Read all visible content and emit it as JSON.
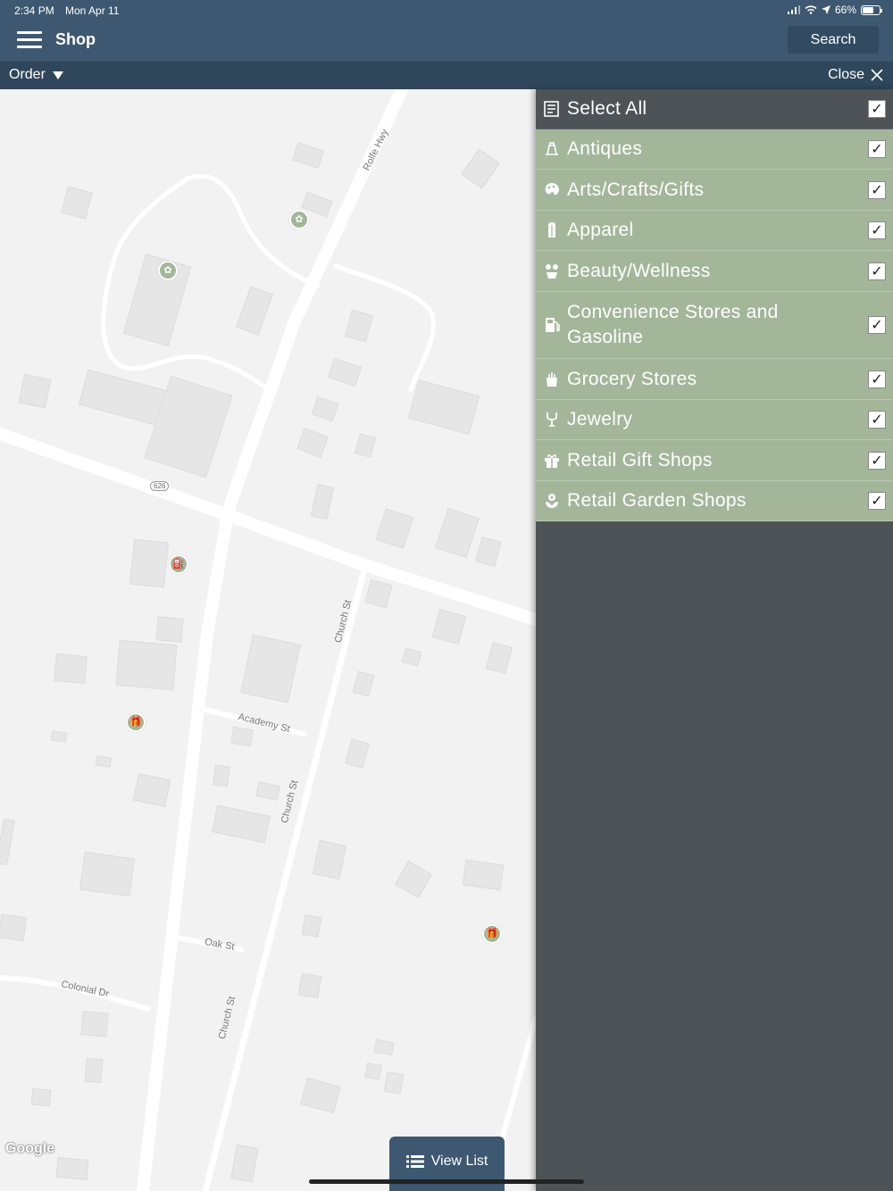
{
  "status_bar": {
    "time": "2:34 PM",
    "date": "Mon Apr 11",
    "battery": "66%"
  },
  "nav": {
    "title": "Shop",
    "search_label": "Search"
  },
  "sub_bar": {
    "order_label": "Order",
    "close_label": "Close"
  },
  "map": {
    "streets": [
      "Rolfe Hwy",
      "Church St",
      "Academy St",
      "Church St",
      "Oak St",
      "Colonial Dr",
      "Church St"
    ],
    "route_badge": "626",
    "attribution": "Google"
  },
  "filter_panel": {
    "select_all": {
      "label": "Select All",
      "checked": true
    },
    "categories": [
      {
        "label": "Antiques",
        "icon": "antiques-icon",
        "checked": true
      },
      {
        "label": "Arts/Crafts/Gifts",
        "icon": "palette-icon",
        "checked": true
      },
      {
        "label": "Apparel",
        "icon": "apparel-icon",
        "checked": true
      },
      {
        "label": "Beauty/Wellness",
        "icon": "beauty-icon",
        "checked": true
      },
      {
        "label": "Convenience Stores and Gasoline",
        "icon": "gas-pump-icon",
        "checked": true
      },
      {
        "label": "Grocery Stores",
        "icon": "grocery-icon",
        "checked": true
      },
      {
        "label": "Jewelry",
        "icon": "ring-icon",
        "checked": true
      },
      {
        "label": "Retail Gift Shops",
        "icon": "gift-icon",
        "checked": true
      },
      {
        "label": "Retail Garden Shops",
        "icon": "flower-icon",
        "checked": true
      }
    ],
    "check_mark": "✓"
  },
  "view_list": {
    "label": "View List"
  },
  "colors": {
    "nav": "#3d5870",
    "sub_bar": "#2f465b",
    "panel": "#4e5357",
    "category": "#a3b69a"
  }
}
